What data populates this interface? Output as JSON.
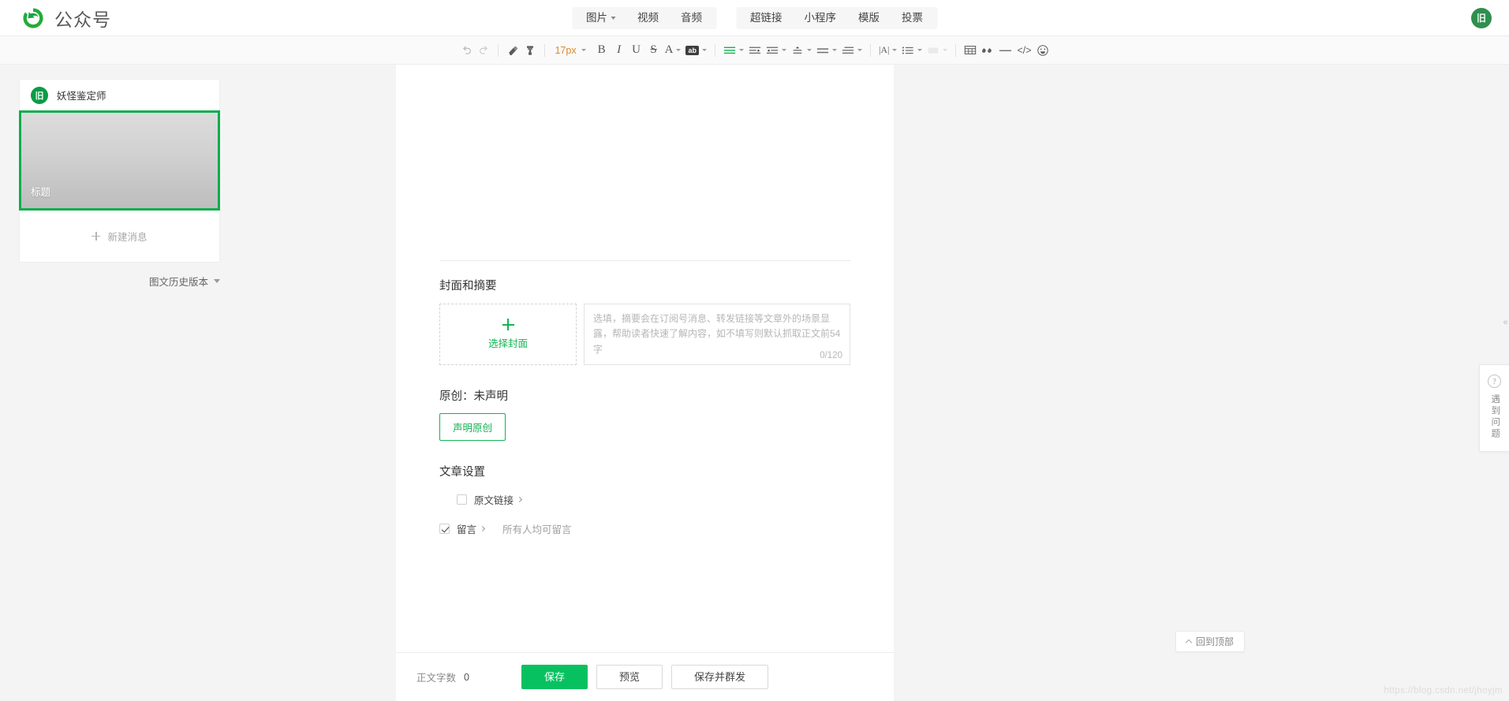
{
  "header": {
    "logo_text": "公众号",
    "logo_icon": "wechat-swirl-logo",
    "avatar_glyph": "旧",
    "nav_group_1": [
      {
        "label": "图片",
        "icon": "image-icon",
        "has_caret": true
      },
      {
        "label": "视频",
        "icon": "video-icon",
        "has_caret": false
      },
      {
        "label": "音频",
        "icon": "audio-icon",
        "has_caret": false
      }
    ],
    "nav_group_2": [
      {
        "label": "超链接",
        "icon": "link-icon"
      },
      {
        "label": "小程序",
        "icon": "miniprogram-icon"
      },
      {
        "label": "模版",
        "icon": "template-icon"
      },
      {
        "label": "投票",
        "icon": "vote-icon"
      }
    ]
  },
  "toolbar": {
    "font_size": "17px",
    "items": [
      {
        "name": "undo-icon",
        "glyph": "↶"
      },
      {
        "name": "redo-icon",
        "glyph": "↷"
      },
      {
        "name": "clear-format-icon",
        "glyph": "◆"
      },
      {
        "name": "format-painter-icon",
        "glyph": "⌖"
      },
      {
        "name": "bold-icon",
        "glyph": "B"
      },
      {
        "name": "italic-icon",
        "glyph": "I"
      },
      {
        "name": "underline-icon",
        "glyph": "U"
      },
      {
        "name": "strikethrough-icon",
        "glyph": "S"
      },
      {
        "name": "text-color-icon",
        "glyph": "A"
      },
      {
        "name": "highlight-color-icon",
        "glyph": "ab"
      },
      {
        "name": "align-left-icon",
        "glyph": "≡"
      },
      {
        "name": "indent-increase-icon",
        "glyph": "⇥"
      },
      {
        "name": "indent-decrease-icon",
        "glyph": "⇤"
      },
      {
        "name": "line-height-icon",
        "glyph": "↕"
      },
      {
        "name": "paragraph-spacing-icon",
        "glyph": "≡"
      },
      {
        "name": "text-indent-icon",
        "glyph": "≡"
      },
      {
        "name": "letter-spacing-icon",
        "glyph": "|A|"
      },
      {
        "name": "bullet-list-icon",
        "glyph": "☰"
      },
      {
        "name": "background-icon",
        "glyph": "▭"
      },
      {
        "name": "table-icon",
        "glyph": "⊞"
      },
      {
        "name": "quote-icon",
        "glyph": "❞"
      },
      {
        "name": "horizontal-rule-icon",
        "glyph": "—"
      },
      {
        "name": "code-icon",
        "glyph": "</>"
      },
      {
        "name": "emoji-icon",
        "glyph": "☺"
      }
    ]
  },
  "left_panel": {
    "account_name": "妖怪鉴定师",
    "account_avatar": "account-avatar",
    "message_title_placeholder": "标题",
    "new_message_label": "新建消息",
    "history_label": "图文历史版本"
  },
  "editor": {
    "cover_section_title": "封面和摘要",
    "cover_select_label": "选择封面",
    "digest_placeholder": "选填，摘要会在订阅号消息、转发链接等文章外的场景显露，帮助读者快速了解内容，如不填写则默认抓取正文前54字",
    "digest_counter": "0/120",
    "original_section_title": "原创：未声明",
    "declare_original_label": "声明原创",
    "settings_title": "文章设置",
    "setting_original_link": "原文链接",
    "setting_comment": "留言",
    "setting_comment_note": "所有人均可留言",
    "original_link_checked": false,
    "comment_checked": true
  },
  "footer": {
    "word_count_label": "正文字数",
    "word_count_value": "0",
    "save_label": "保存",
    "preview_label": "预览",
    "save_and_send_label": "保存并群发"
  },
  "right_rail": {
    "help_icon": "question-mark-icon",
    "help_text": "遇到问题",
    "back_to_top_label": "回到顶部",
    "collapse_glyph": "«"
  },
  "watermark": "https://blog.csdn.net/jhoyjm",
  "colors": {
    "brand_green": "#07c160",
    "accent_green": "#14b353",
    "selection_green": "#10ad4c",
    "font_size_orange": "#d88a2b"
  }
}
